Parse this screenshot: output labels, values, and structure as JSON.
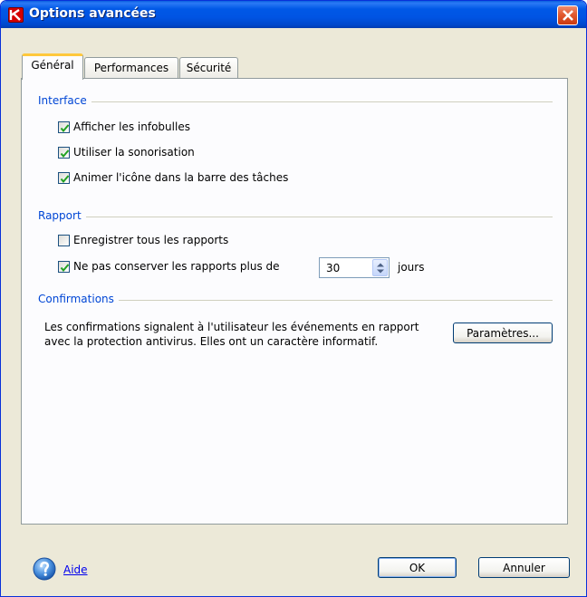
{
  "window": {
    "title": "Options avancées",
    "title_icon": "kaspersky-k-icon",
    "close_icon": "close-icon",
    "accent_color": "#0054e3"
  },
  "tabs": [
    {
      "label": "Général",
      "active": true
    },
    {
      "label": "Performances",
      "active": false
    },
    {
      "label": "Sécurité",
      "active": false
    }
  ],
  "interface_group": {
    "label": "Interface",
    "options": [
      {
        "label": "Afficher les infobulles",
        "checked": true
      },
      {
        "label": "Utiliser la sonorisation",
        "checked": true
      },
      {
        "label": "Animer l'icône dans la barre des tâches",
        "checked": true
      }
    ]
  },
  "report_group": {
    "label": "Rapport",
    "options": [
      {
        "label": "Enregistrer tous les rapports",
        "checked": false
      },
      {
        "label": "Ne pas conserver les rapports plus de",
        "checked": true
      }
    ],
    "days_value": "30",
    "days_unit": "jours"
  },
  "confirmations_group": {
    "label": "Confirmations",
    "description": "Les confirmations signalent à l'utilisateur les événements en rapport avec la protection antivirus. Elles ont un caractère informatif.",
    "settings_button": "Paramètres..."
  },
  "footer": {
    "help_label": "Aide",
    "help_icon": "help-question-icon",
    "ok_label": "OK",
    "cancel_label": "Annuler"
  }
}
